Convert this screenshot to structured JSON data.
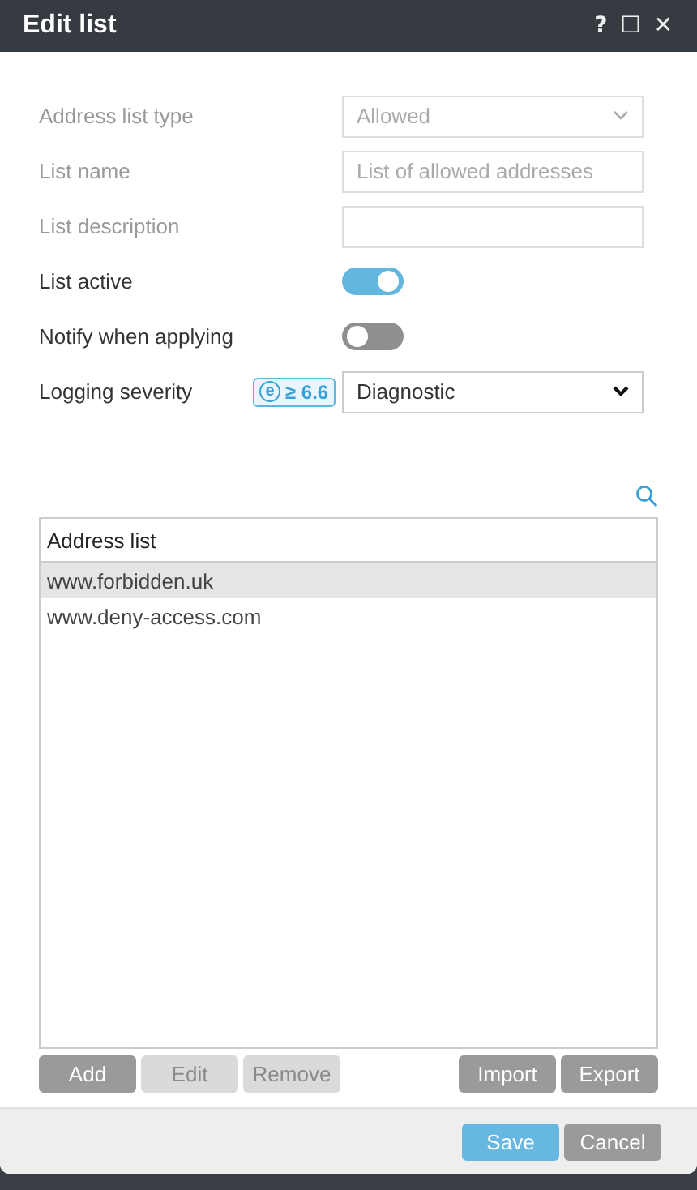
{
  "window": {
    "title": "Edit list",
    "controls": [
      "?",
      "☐",
      "✕"
    ]
  },
  "form": {
    "rows": [
      {
        "kind": "select",
        "label": "Address list type",
        "value": "Allowed",
        "disabled": true
      },
      {
        "kind": "text",
        "label": "List name",
        "value": "List of allowed addresses",
        "disabled": true
      },
      {
        "kind": "text",
        "label": "List description",
        "disabled": true
      },
      {
        "kind": "toggle",
        "label": "List active",
        "on": true
      },
      {
        "kind": "toggle",
        "label": "Notify when applying",
        "on": false
      },
      {
        "kind": "select",
        "label": "Logging severity",
        "badge": {
          "mark": "e",
          "text": "≥ 6.6"
        },
        "value": "Diagnostic",
        "disabled": false
      }
    ]
  },
  "table": {
    "columns": [
      "Address list"
    ],
    "rows": [
      {
        "cells": [
          "www.forbidden.uk"
        ],
        "selected": true
      },
      {
        "cells": [
          "www.deny-access.com"
        ],
        "selected": false
      }
    ]
  },
  "list_buttons_left": [
    {
      "label": "Add",
      "disabled": false
    },
    {
      "label": "Edit",
      "disabled": true
    },
    {
      "label": "Remove",
      "disabled": true
    }
  ],
  "list_buttons_right": [
    {
      "label": "Import",
      "disabled": false
    },
    {
      "label": "Export",
      "disabled": false
    }
  ],
  "footer_buttons": [
    {
      "label": "Save",
      "kind": "primary"
    },
    {
      "label": "Cancel",
      "kind": "secondary"
    }
  ]
}
